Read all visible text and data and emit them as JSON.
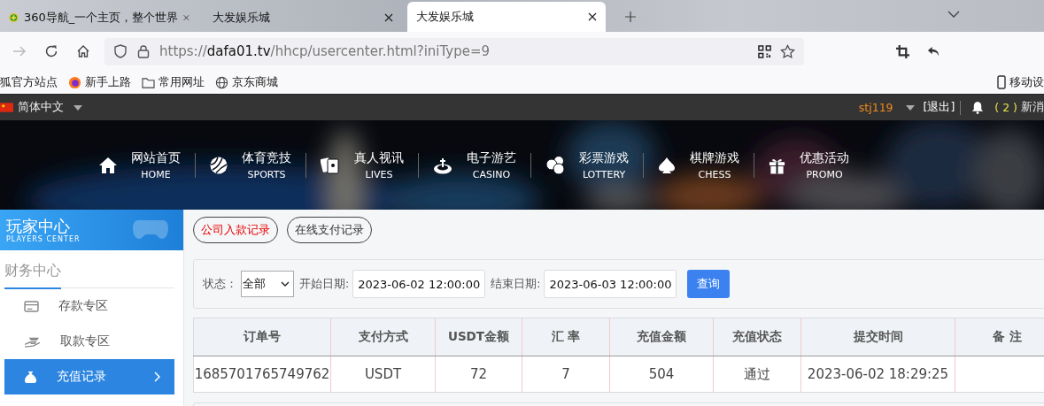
{
  "browser": {
    "tabs": [
      {
        "title": "360导航_一个主页，整个世界",
        "selected": false
      },
      {
        "title": "大发娱乐城",
        "selected": false
      },
      {
        "title": "大发娱乐城",
        "selected": true
      }
    ],
    "url": {
      "scheme": "https://",
      "host": "dafa01.tv",
      "path": "/hhcp/usercenter.html?iniType=9"
    },
    "bookmarks": [
      {
        "label": "狐官方站点"
      },
      {
        "label": "新手上路"
      },
      {
        "label": "常用网址"
      },
      {
        "label": "京东商城"
      }
    ],
    "mobile_bookmark": "移动设"
  },
  "site": {
    "language": "简体中文",
    "username": "stj119",
    "logout": "[退出]",
    "message_count": "( 2 )",
    "message_label": "新消"
  },
  "nav": [
    {
      "label": "网站首页",
      "sub": "HOME"
    },
    {
      "label": "体育竞技",
      "sub": "SPORTS"
    },
    {
      "label": "真人视讯",
      "sub": "LIVES"
    },
    {
      "label": "电子游艺",
      "sub": "CASINO"
    },
    {
      "label": "彩票游戏",
      "sub": "LOTTERY"
    },
    {
      "label": "棋牌游戏",
      "sub": "CHESS"
    },
    {
      "label": "优惠活动",
      "sub": "PROMO"
    }
  ],
  "sidebar": {
    "title": "玩家中心",
    "subtitle": "PLAYERS CENTER",
    "section": "财务中心",
    "items": [
      {
        "label": "存款专区",
        "selected": false
      },
      {
        "label": "取款专区",
        "selected": false
      },
      {
        "label": "充值记录",
        "selected": true
      }
    ]
  },
  "record_tabs": [
    {
      "label": "公司入款记录",
      "selected": true
    },
    {
      "label": "在线支付记录",
      "selected": false
    }
  ],
  "filter": {
    "status_label": "状态：",
    "status_value": "全部",
    "start_label": "开始日期:",
    "start_value": "2023-06-02 12:00:00",
    "end_label": "结束日期:",
    "end_value": "2023-06-03 12:00:00",
    "button": "查询"
  },
  "table": {
    "columns": [
      "订单号",
      "支付方式",
      "USDT金额",
      "汇 率",
      "充值金额",
      "充值状态",
      "提交时间",
      "备 注"
    ],
    "rows": [
      [
        "1685701765749762",
        "USDT",
        "72",
        "7",
        "504",
        "通过",
        "2023-06-02 18:29:25",
        ""
      ]
    ]
  }
}
